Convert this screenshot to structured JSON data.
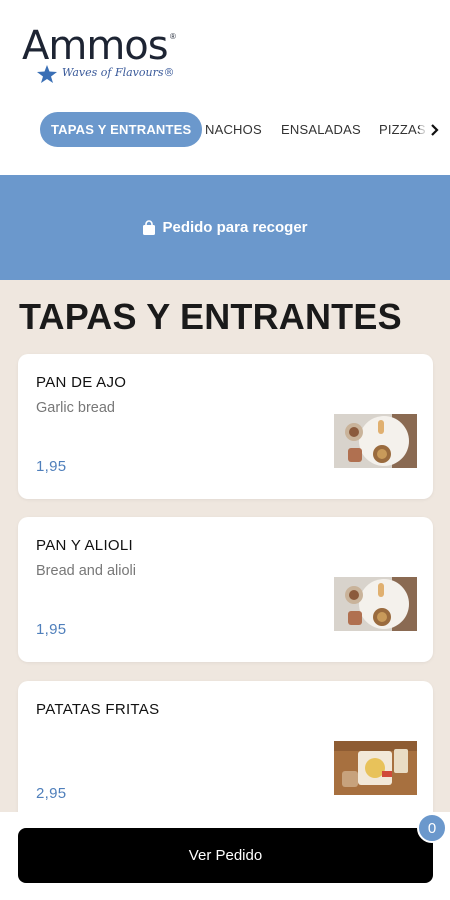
{
  "brand": {
    "name": "Ammos",
    "registered_mark": "®",
    "tagline": "Waves of Flavours®"
  },
  "tabs": [
    {
      "label": "TAPAS Y ENTRANTES",
      "active": true
    },
    {
      "label": "NACHOS",
      "active": false
    },
    {
      "label": "ENSALADAS",
      "active": false
    },
    {
      "label": "PIZZAS",
      "active": false
    }
  ],
  "tabs_next_icon": "chevron-right-icon",
  "banner": {
    "icon": "shopping-bag-icon",
    "label": "Pedido para recoger"
  },
  "section": {
    "title": "TAPAS Y ENTRANTES"
  },
  "items": [
    {
      "name": "PAN DE AJO",
      "description": "Garlic bread",
      "price": "1,95",
      "image": "tapas-photo"
    },
    {
      "name": "PAN Y ALIOLI",
      "description": "Bread and alioli",
      "price": "1,95",
      "image": "tapas-photo"
    },
    {
      "name": "PATATAS FRITAS",
      "description": "",
      "price": "2,95",
      "image": "fries-photo"
    }
  ],
  "order": {
    "button_label": "Ver Pedido",
    "count": "0"
  },
  "colors": {
    "accent": "#6b98cc",
    "price": "#4f7fbb",
    "background": "#efe7df"
  }
}
